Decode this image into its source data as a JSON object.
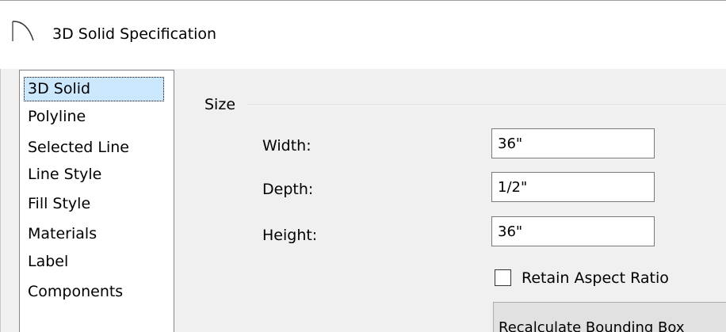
{
  "window": {
    "title": "3D Solid Specification",
    "title_icon": "arc-tool-icon"
  },
  "nav": {
    "selected_index": 0,
    "items": [
      {
        "label": "3D Solid"
      },
      {
        "label": "Polyline"
      },
      {
        "label": "Selected Line"
      },
      {
        "label": "Line Style"
      },
      {
        "label": "Fill Style"
      },
      {
        "label": "Materials"
      },
      {
        "label": "Label"
      },
      {
        "label": "Components"
      }
    ]
  },
  "size_group": {
    "label": "Size",
    "width": {
      "label": "Width:",
      "value": "36\""
    },
    "depth": {
      "label": "Depth:",
      "value": "1/2\""
    },
    "height": {
      "label": "Height:",
      "value": "36\""
    },
    "retain_aspect_ratio": {
      "label": "Retain Aspect Ratio",
      "checked": false
    },
    "recalculate_button": {
      "label": "Recalculate Bounding Box"
    }
  },
  "colors": {
    "selection_background": "#cce8ff",
    "dialog_background": "#f0f0f0",
    "input_border": "#7a7a7a"
  }
}
